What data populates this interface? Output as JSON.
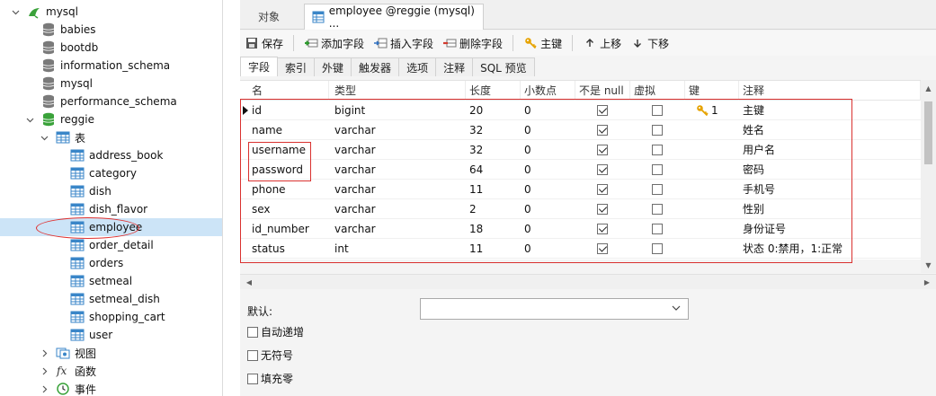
{
  "sidebar": {
    "items": [
      {
        "label": "mysql",
        "icon": "dolphin-icon"
      },
      {
        "label": "babies",
        "icon": "database-icon"
      },
      {
        "label": "bootdb",
        "icon": "database-icon"
      },
      {
        "label": "information_schema",
        "icon": "database-icon"
      },
      {
        "label": "mysql",
        "icon": "database-icon"
      },
      {
        "label": "performance_schema",
        "icon": "database-icon"
      },
      {
        "label": "reggie",
        "icon": "database-open-icon"
      },
      {
        "label": "表",
        "icon": "tables-folder-icon"
      },
      {
        "label": "address_book",
        "icon": "table-icon"
      },
      {
        "label": "category",
        "icon": "table-icon"
      },
      {
        "label": "dish",
        "icon": "table-icon"
      },
      {
        "label": "dish_flavor",
        "icon": "table-icon"
      },
      {
        "label": "employee",
        "icon": "table-icon"
      },
      {
        "label": "order_detail",
        "icon": "table-icon"
      },
      {
        "label": "orders",
        "icon": "table-icon"
      },
      {
        "label": "setmeal",
        "icon": "table-icon"
      },
      {
        "label": "setmeal_dish",
        "icon": "table-icon"
      },
      {
        "label": "shopping_cart",
        "icon": "table-icon"
      },
      {
        "label": "user",
        "icon": "table-icon"
      },
      {
        "label": "视图",
        "icon": "views-icon"
      },
      {
        "label": "函数",
        "icon": "function-icon"
      },
      {
        "label": "事件",
        "icon": "event-clock-icon"
      }
    ],
    "selected": "employee"
  },
  "tabs": {
    "objects": "对象",
    "editor": "employee @reggie (mysql) ..."
  },
  "toolbar": {
    "save": "保存",
    "add_field": "添加字段",
    "insert_field": "插入字段",
    "delete_field": "删除字段",
    "primary_key": "主键",
    "move_up": "上移",
    "move_down": "下移"
  },
  "subtabs": [
    "字段",
    "索引",
    "外键",
    "触发器",
    "选项",
    "注释",
    "SQL 预览"
  ],
  "grid": {
    "headers": [
      "名",
      "类型",
      "长度",
      "小数点",
      "不是 null",
      "虚拟",
      "键",
      "注释"
    ],
    "rows": [
      {
        "name": "id",
        "type": "bigint",
        "length": "20",
        "decimals": "0",
        "not_null": true,
        "virtual": false,
        "key": "1",
        "comment": "主键"
      },
      {
        "name": "name",
        "type": "varchar",
        "length": "32",
        "decimals": "0",
        "not_null": true,
        "virtual": false,
        "key": "",
        "comment": "姓名"
      },
      {
        "name": "username",
        "type": "varchar",
        "length": "32",
        "decimals": "0",
        "not_null": true,
        "virtual": false,
        "key": "",
        "comment": "用户名"
      },
      {
        "name": "password",
        "type": "varchar",
        "length": "64",
        "decimals": "0",
        "not_null": true,
        "virtual": false,
        "key": "",
        "comment": "密码"
      },
      {
        "name": "phone",
        "type": "varchar",
        "length": "11",
        "decimals": "0",
        "not_null": true,
        "virtual": false,
        "key": "",
        "comment": "手机号"
      },
      {
        "name": "sex",
        "type": "varchar",
        "length": "2",
        "decimals": "0",
        "not_null": true,
        "virtual": false,
        "key": "",
        "comment": "性别"
      },
      {
        "name": "id_number",
        "type": "varchar",
        "length": "18",
        "decimals": "0",
        "not_null": true,
        "virtual": false,
        "key": "",
        "comment": "身份证号"
      },
      {
        "name": "status",
        "type": "int",
        "length": "11",
        "decimals": "0",
        "not_null": true,
        "virtual": false,
        "key": "",
        "comment": "状态 0:禁用，1:正常"
      }
    ]
  },
  "props": {
    "default_label": "默认:",
    "default_value": "",
    "auto_increment": "自动递增",
    "unsigned": "无符号",
    "zerofill": "填充零"
  },
  "colors": {
    "annotation_red": "#d9312f",
    "selection_blue": "#cce4f7",
    "db_green": "#3aa23a"
  }
}
